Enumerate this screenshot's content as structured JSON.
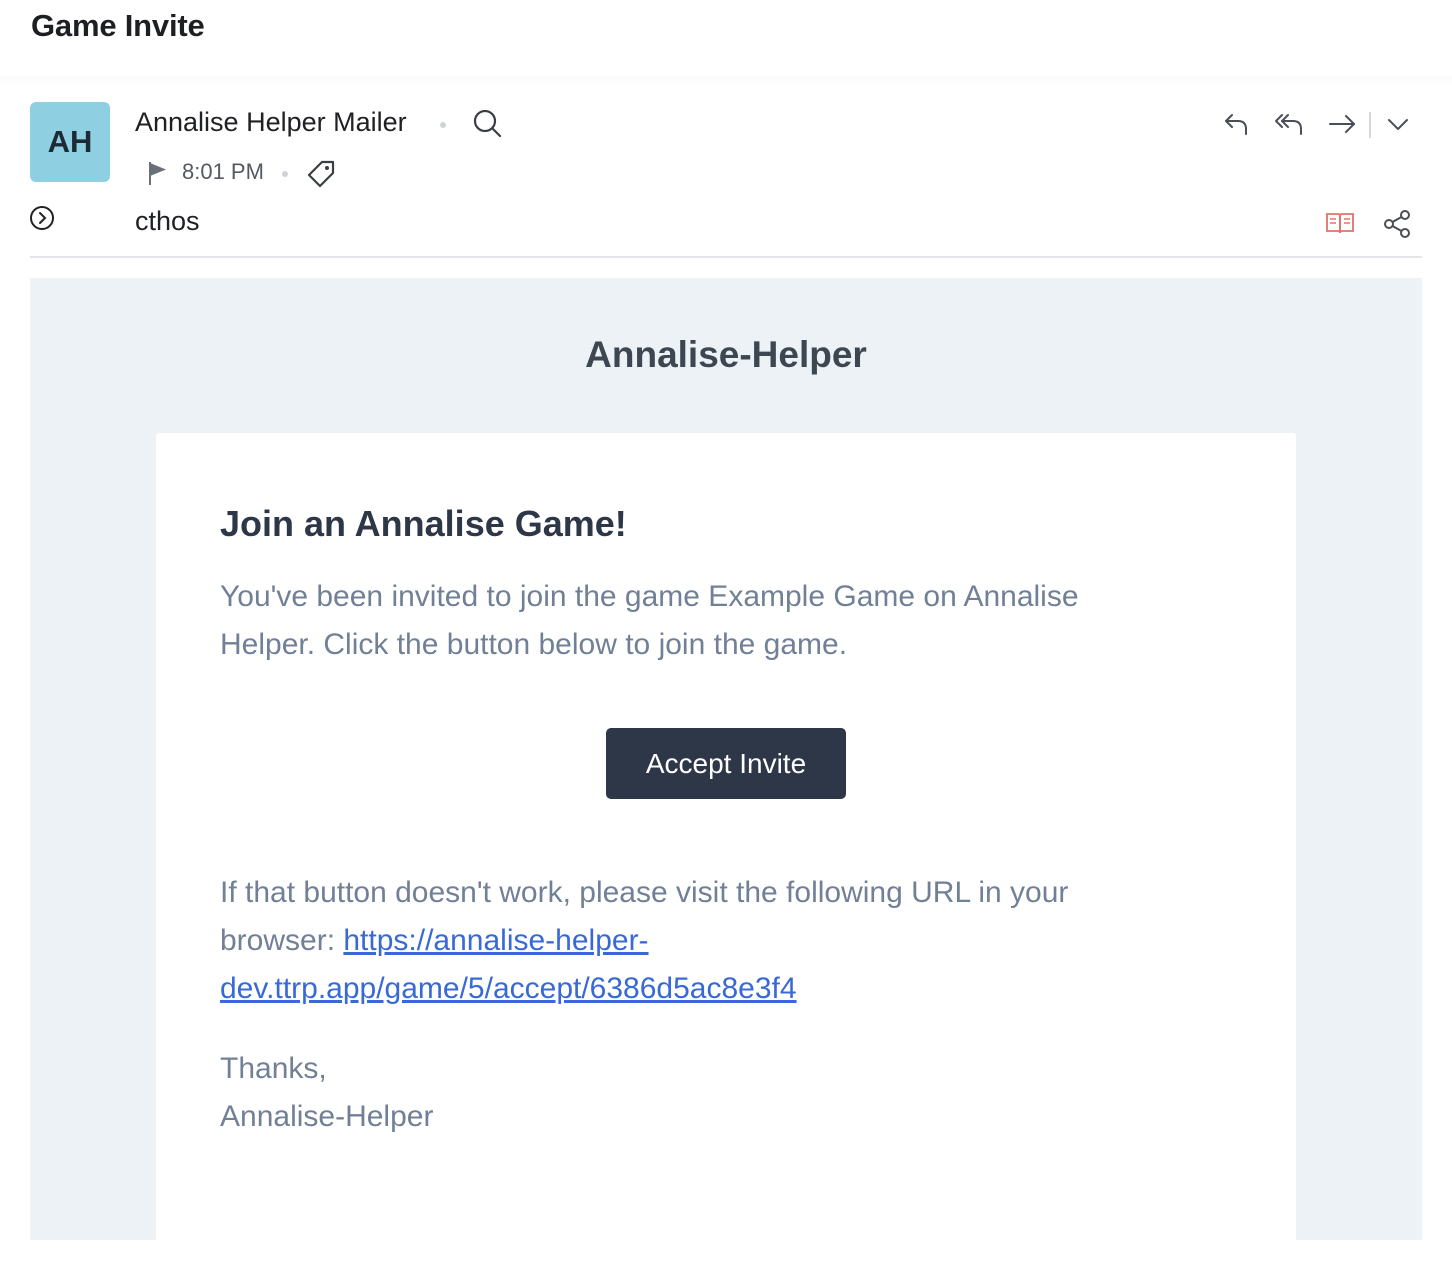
{
  "subject": "Game Invite",
  "sender": {
    "initials": "AH",
    "name": "Annalise Helper Mailer",
    "time": "8:01 PM",
    "recipient": "cthos",
    "avatar_color": "#8ecfe1"
  },
  "toolbar": {
    "icons": [
      "reply-icon",
      "reply-all-icon",
      "forward-icon",
      "more-actions-chevron-icon",
      "reader-view-icon",
      "share-icon"
    ]
  },
  "email": {
    "brand": "Annalise-Helper",
    "heading": "Join an Annalise Game!",
    "intro": "You've been invited to join the game Example Game on Annalise Helper. Click the button below to join the game.",
    "button_label": "Accept Invite",
    "fallback_prefix": "If that button doesn't work, please visit the following URL in your browser: ",
    "url": "https://annalise-helper-dev.ttrp.app/game/5/accept/6386d5ac8e3f4",
    "signoff_1": "Thanks,",
    "signoff_2": "Annalise-Helper",
    "accent_color": "#2d3748",
    "link_color": "#3869d4"
  }
}
